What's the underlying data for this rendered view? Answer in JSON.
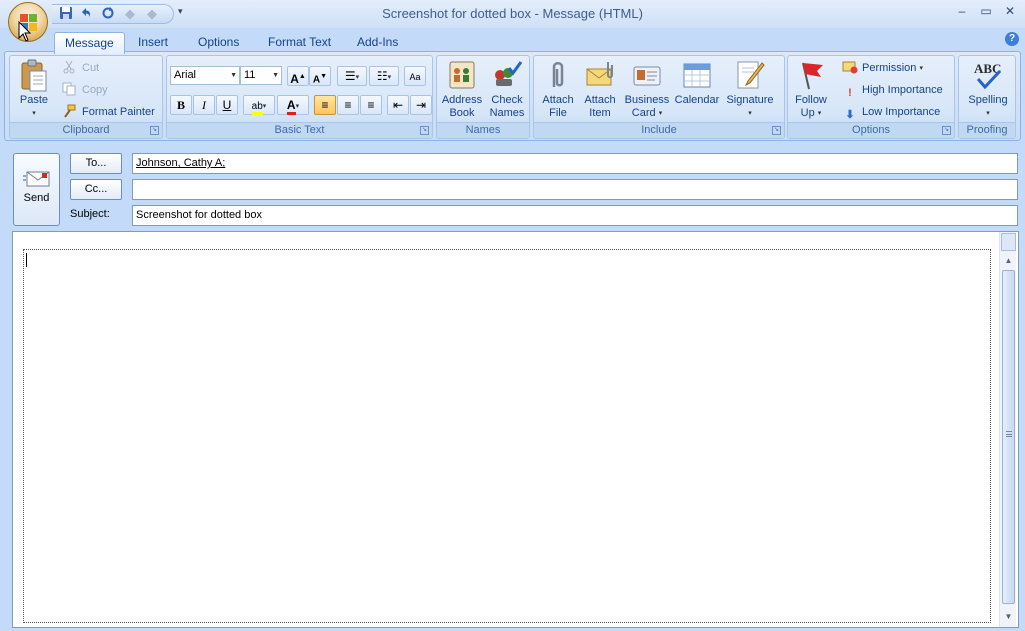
{
  "window": {
    "title": "Screenshot for dotted box - Message (HTML)",
    "controls": {
      "minimize": "‒",
      "maximize": "▭",
      "close": "✕"
    }
  },
  "quick_access": {
    "save": "save-icon",
    "undo": "undo-icon",
    "redo": "redo-icon",
    "more": "▾"
  },
  "tabs": [
    {
      "label": "Message",
      "active": true
    },
    {
      "label": "Insert"
    },
    {
      "label": "Options"
    },
    {
      "label": "Format Text"
    },
    {
      "label": "Add-Ins"
    }
  ],
  "ribbon": {
    "clipboard": {
      "label": "Clipboard",
      "paste": "Paste",
      "cut": "Cut",
      "copy": "Copy",
      "format_painter": "Format Painter"
    },
    "basic_text": {
      "label": "Basic Text",
      "font": "Arial",
      "size": "11",
      "bold": "B",
      "italic": "I",
      "underline": "U"
    },
    "names": {
      "label": "Names",
      "address_book": [
        "Address",
        "Book"
      ],
      "check_names": [
        "Check",
        "Names"
      ]
    },
    "include": {
      "label": "Include",
      "attach_file": [
        "Attach",
        "File"
      ],
      "attach_item": [
        "Attach",
        "Item"
      ],
      "business_card": [
        "Business",
        "Card"
      ],
      "calendar": "Calendar",
      "signature": "Signature"
    },
    "options": {
      "label": "Options",
      "follow_up": [
        "Follow",
        "Up"
      ],
      "permission": "Permission",
      "high_importance": "High Importance",
      "low_importance": "Low Importance"
    },
    "proofing": {
      "label": "Proofing",
      "spelling": "Spelling",
      "abc": "ABC"
    }
  },
  "message": {
    "send_label": "Send",
    "to_button": "To...",
    "cc_button": "Cc...",
    "subject_label": "Subject:",
    "to_value": "Johnson, Cathy A;",
    "cc_value": "",
    "subject_value": "Screenshot for dotted box",
    "body": ""
  },
  "colors": {
    "ribbon_bg": "#c3daf9",
    "accent": "#15428b",
    "active_button": "#ffc35e"
  }
}
